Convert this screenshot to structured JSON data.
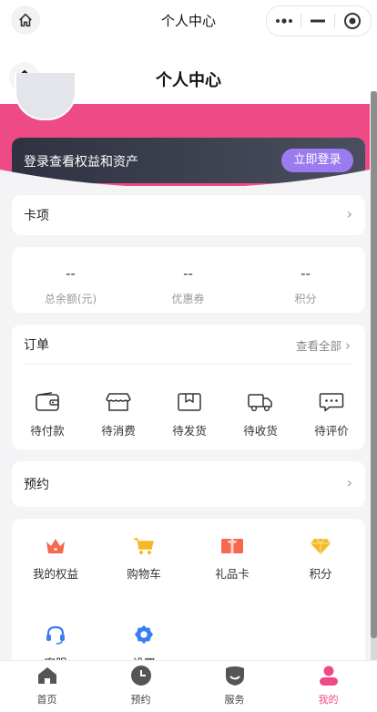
{
  "topbar": {
    "title": "个人中心"
  },
  "header": {
    "title": "个人中心"
  },
  "login": {
    "prompt": "登录查看权益和资产",
    "button": "立即登录"
  },
  "card_row": {
    "label": "卡项"
  },
  "assets": [
    {
      "value": "--",
      "label": "总余额(元)"
    },
    {
      "value": "--",
      "label": "优惠券"
    },
    {
      "value": "--",
      "label": "积分"
    }
  ],
  "orders": {
    "title": "订单",
    "view_all": "查看全部",
    "items": [
      {
        "icon": "wallet-icon",
        "label": "待付款"
      },
      {
        "icon": "store-icon",
        "label": "待消费"
      },
      {
        "icon": "box-icon",
        "label": "待发货"
      },
      {
        "icon": "truck-icon",
        "label": "待收货"
      },
      {
        "icon": "comment-icon",
        "label": "待评价"
      }
    ]
  },
  "booking": {
    "label": "预约"
  },
  "services": [
    {
      "icon": "crown-icon",
      "label": "我的权益",
      "color": "#f4694f"
    },
    {
      "icon": "cart-icon",
      "label": "购物车",
      "color": "#f6b827"
    },
    {
      "icon": "gift-card-icon",
      "label": "礼品卡",
      "color": "#f4694f"
    },
    {
      "icon": "diamond-icon",
      "label": "积分",
      "color": "#f6b827"
    },
    {
      "icon": "headset-icon",
      "label": "客服",
      "color": "#3b7ef0"
    },
    {
      "icon": "settings-icon",
      "label": "设置",
      "color": "#3b7ef0"
    }
  ],
  "tabbar": [
    {
      "icon": "home-icon",
      "label": "首页",
      "active": false
    },
    {
      "icon": "clock-icon",
      "label": "预约",
      "active": false
    },
    {
      "icon": "service-icon",
      "label": "服务",
      "active": false
    },
    {
      "icon": "user-icon",
      "label": "我的",
      "active": true
    }
  ],
  "colors": {
    "brand_pink": "#ee4b86",
    "login_button": "#9a7bf0",
    "dark_card": "#2f3240"
  }
}
